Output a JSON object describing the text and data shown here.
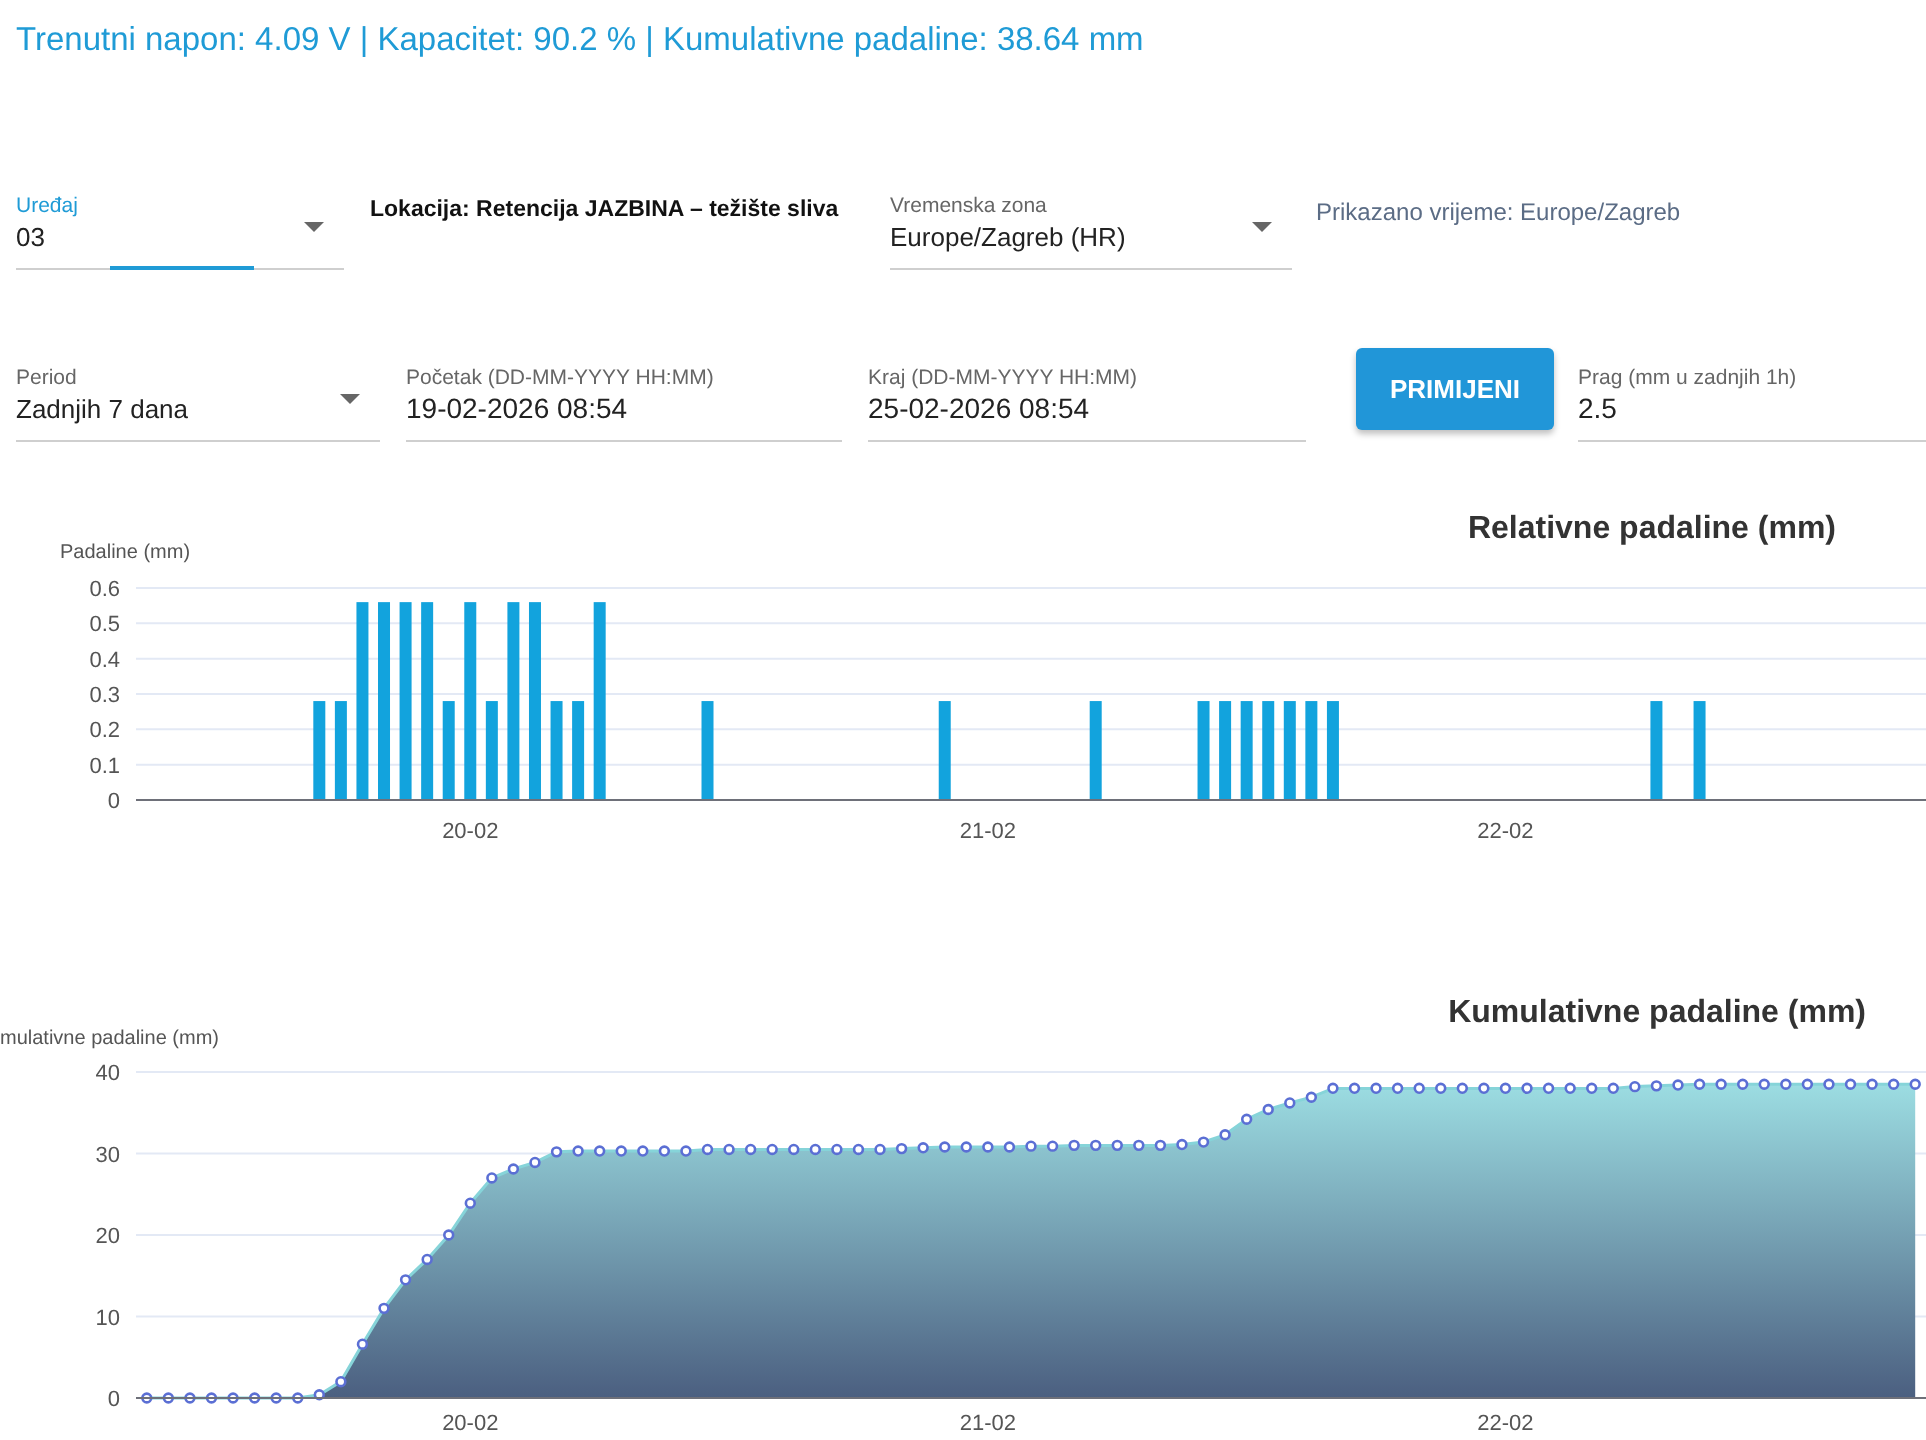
{
  "status_line": "Trenutni napon: 4.09 V | Kapacitet: 90.2 % | Kumulativne padaline: 38.64 mm",
  "controls": [
    {
      "items": [
        {
          "kind": "select",
          "label": "Uređaj",
          "value": "03",
          "focused": true
        },
        {
          "kind": "text",
          "text": "Lokacija: Retencija JAZBINA – težište sliva"
        },
        {
          "kind": "select",
          "label": "Vremenska zona",
          "value": "Europe/Zagreb (HR)",
          "focused": false
        },
        {
          "kind": "note",
          "text": "Prikazano vrijeme: Europe/Zagreb"
        }
      ]
    },
    {
      "items": [
        {
          "kind": "select",
          "label": "Period",
          "value": "Zadnjih 7 dana",
          "focused": false
        },
        {
          "kind": "input",
          "label": "Početak (DD-MM-YYYY HH:MM)",
          "value": "19-02-2026 08:54",
          "focused": false
        },
        {
          "kind": "input",
          "label": "Kraj (DD-MM-YYYY HH:MM)",
          "value": "25-02-2026 08:54",
          "focused": false
        },
        {
          "kind": "button",
          "label": "PRIMIJENI"
        },
        {
          "kind": "input",
          "label": "Prag (mm u zadnjih 1h)",
          "value": "2.5",
          "focused": false
        }
      ]
    }
  ],
  "charts": [
    {
      "chart_data": {
        "type": "bar",
        "title": "Relativne padaline (mm)",
        "ylabel": "Padaline (mm)",
        "categories": [
          null,
          null,
          null,
          null,
          null,
          null,
          null,
          null,
          null,
          null,
          null,
          null,
          null,
          null,
          null,
          "20-02",
          null,
          null,
          null,
          null,
          null,
          null,
          null,
          null,
          null,
          null,
          null,
          null,
          null,
          null,
          null,
          null,
          null,
          null,
          null,
          null,
          null,
          null,
          null,
          "21-02",
          null,
          null,
          null,
          null,
          null,
          null,
          null,
          null,
          null,
          null,
          null,
          null,
          null,
          null,
          null,
          null,
          null,
          null,
          null,
          null,
          null,
          null,
          null,
          "22-02",
          null,
          null,
          null,
          null,
          null,
          null,
          null,
          null,
          null,
          null,
          null,
          null,
          null,
          null,
          null,
          null,
          null,
          null,
          null
        ],
        "values": [
          null,
          null,
          null,
          null,
          null,
          null,
          null,
          null,
          0.28,
          0.28,
          0.56,
          0.56,
          0.56,
          0.56,
          0.28,
          0.56,
          0.28,
          0.56,
          0.56,
          0.28,
          0.28,
          0.56,
          null,
          null,
          null,
          null,
          0.28,
          null,
          null,
          null,
          null,
          null,
          null,
          null,
          null,
          null,
          null,
          0.28,
          null,
          null,
          null,
          null,
          null,
          null,
          0.28,
          null,
          null,
          null,
          null,
          0.28,
          0.28,
          0.28,
          0.28,
          0.28,
          0.28,
          0.28,
          null,
          null,
          null,
          null,
          null,
          null,
          null,
          null,
          null,
          null,
          null,
          null,
          null,
          null,
          0.28,
          null,
          0.28,
          null,
          null,
          null,
          null,
          null,
          null,
          null,
          null,
          null,
          null
        ],
        "ylim": [
          0,
          0.6
        ],
        "grid": true,
        "yticks": [
          0,
          0.1,
          0.2,
          0.3,
          0.4,
          0.5,
          0.6
        ]
      }
    },
    {
      "chart_data": {
        "type": "area",
        "title": "Kumulativne padaline (mm)",
        "ylabel": "mulativne padaline (mm)",
        "categories": [
          null,
          null,
          null,
          null,
          null,
          null,
          null,
          null,
          null,
          null,
          null,
          null,
          null,
          null,
          null,
          "20-02",
          null,
          null,
          null,
          null,
          null,
          null,
          null,
          null,
          null,
          null,
          null,
          null,
          null,
          null,
          null,
          null,
          null,
          null,
          null,
          null,
          null,
          null,
          null,
          "21-02",
          null,
          null,
          null,
          null,
          null,
          null,
          null,
          null,
          null,
          null,
          null,
          null,
          null,
          null,
          null,
          null,
          null,
          null,
          null,
          null,
          null,
          null,
          null,
          "22-02",
          null,
          null,
          null,
          null,
          null,
          null,
          null,
          null,
          null,
          null,
          null,
          null,
          null,
          null,
          null,
          null,
          null,
          null,
          null
        ],
        "series": [
          {
            "color": "#5b6fd4",
            "values": [
              0,
              0,
              0,
              0,
              0,
              0,
              0,
              0,
              0.4,
              2,
              6.6,
              11,
              14.5,
              17,
              20,
              23.9,
              27,
              28.1,
              28.9,
              30.2,
              30.3,
              30.3,
              30.3,
              30.3,
              30.3,
              30.3,
              30.5,
              30.5,
              30.5,
              30.5,
              30.5,
              30.5,
              30.5,
              30.5,
              30.5,
              30.6,
              30.7,
              30.8,
              30.8,
              30.8,
              30.8,
              30.9,
              30.9,
              31,
              31,
              31,
              31,
              31,
              31.1,
              31.4,
              32.3,
              34.2,
              35.4,
              36.2,
              36.9,
              38,
              38,
              38,
              38,
              38,
              38,
              38,
              38,
              38,
              38,
              38,
              38,
              38,
              38,
              38.2,
              38.3,
              38.4,
              38.5,
              38.5,
              38.5,
              38.5,
              38.5,
              38.5,
              38.5,
              38.5,
              38.5,
              38.5,
              38.5
            ]
          }
        ],
        "ylim": [
          0,
          40
        ],
        "grid": true,
        "yticks": [
          0,
          10,
          20,
          30,
          40
        ]
      }
    }
  ]
}
